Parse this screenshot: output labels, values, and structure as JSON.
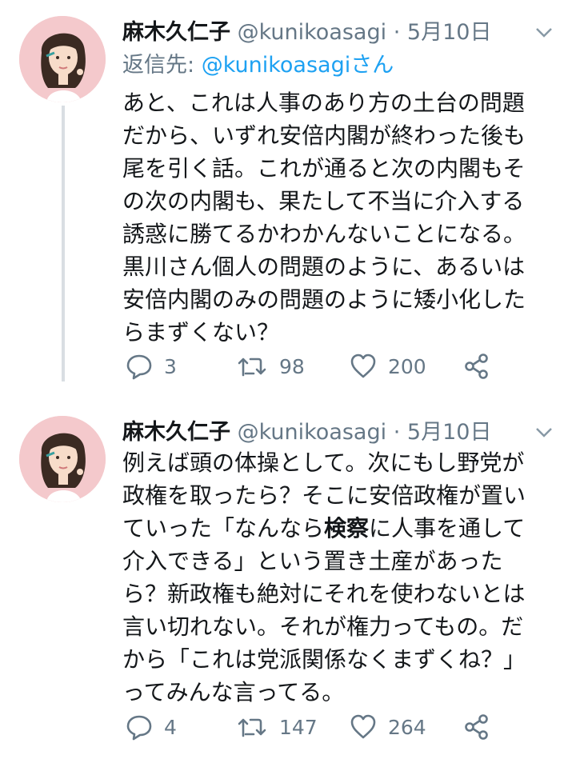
{
  "colors": {
    "text": "#14171a",
    "secondary": "#657786",
    "link": "#1da1f2",
    "line": "#d9dee3",
    "avatar_bg": "#f4c9cc"
  },
  "tweets": [
    {
      "name": "麻木久仁子",
      "handle": "@kunikoasagi",
      "dot": "·",
      "date": "5月10日",
      "reply_prefix": "返信先: ",
      "reply_mention": "@kunikoasagiさん",
      "lines": [
        "あと、これは人事のあり方の土台の問題",
        "だから、いずれ安倍内閣が終わった後も",
        "尾を引く話。これが通ると次の内閣もそ",
        "の次の内閣も、果たして不当に介入する",
        "誘惑に勝てるかわかんないことになる。",
        "黒川さん個人の問題のように、あるいは",
        "安倍内閣のみの問題のように矮小化した",
        "らまずくない？"
      ],
      "replies": "3",
      "retweets": "98",
      "likes": "200"
    },
    {
      "name": "麻木久仁子",
      "handle": "@kunikoasagi",
      "dot": "·",
      "date": "5月10日",
      "lines": [
        "例えば頭の体操として。次にもし野党が",
        "政権を取ったら？そこに安倍政権が置い"
      ],
      "line3_a": "ていった「なんなら",
      "line3_bold": "検察",
      "line3_b": "に人事を通して",
      "lines_rest": [
        "介入できる」という置き土産があった",
        "ら？新政権も絶対にそれを使わないとは",
        "言い切れない。それが権力ってもの。だ",
        "から「これは党派関係なくまずくね？」",
        "ってみんな言ってる。"
      ],
      "replies": "4",
      "retweets": "147",
      "likes": "264"
    }
  ]
}
